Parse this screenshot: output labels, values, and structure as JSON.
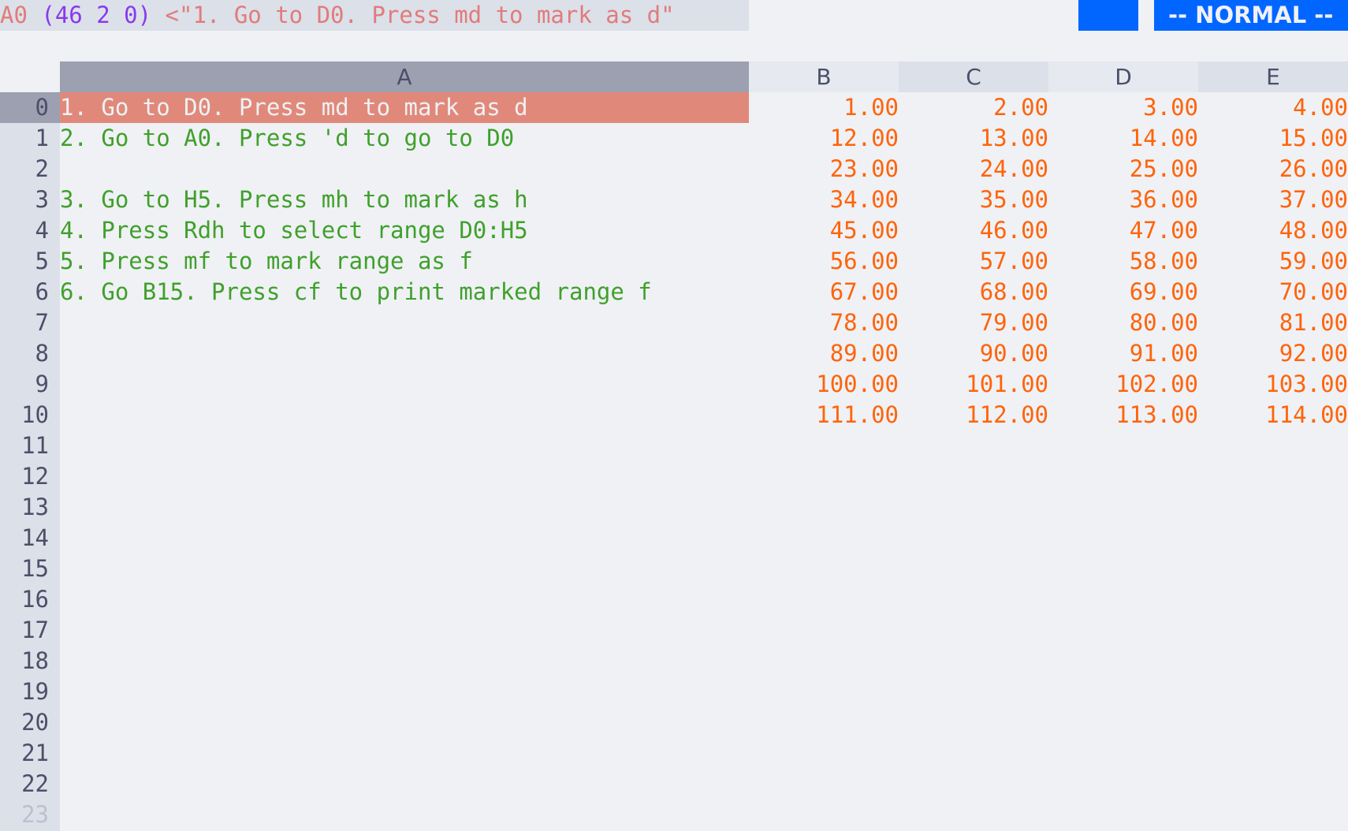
{
  "status_line": {
    "cell_ref": "A0",
    "cell_nums": "(46 2 0)",
    "cell_value": "<\"1. Go to D0. Press md to mark as d\"",
    "mode": "-- NORMAL --"
  },
  "columns": [
    "A",
    "B",
    "C",
    "D",
    "E"
  ],
  "rows": [
    {
      "n": "0",
      "a": "1. Go to D0. Press md to mark as d",
      "b": "1.00",
      "c": "2.00",
      "d": "3.00",
      "e": "4.00"
    },
    {
      "n": "1",
      "a": "2. Go to A0. Press 'd to go to D0",
      "b": "12.00",
      "c": "13.00",
      "d": "14.00",
      "e": "15.00"
    },
    {
      "n": "2",
      "a": "",
      "b": "23.00",
      "c": "24.00",
      "d": "25.00",
      "e": "26.00"
    },
    {
      "n": "3",
      "a": "3. Go to H5. Press mh to mark as h",
      "b": "34.00",
      "c": "35.00",
      "d": "36.00",
      "e": "37.00"
    },
    {
      "n": "4",
      "a": "4. Press Rdh to select range D0:H5",
      "b": "45.00",
      "c": "46.00",
      "d": "47.00",
      "e": "48.00"
    },
    {
      "n": "5",
      "a": "5. Press mf to mark range as f",
      "b": "56.00",
      "c": "57.00",
      "d": "58.00",
      "e": "59.00"
    },
    {
      "n": "6",
      "a": "6. Go B15. Press cf to print marked range f",
      "b": "67.00",
      "c": "68.00",
      "d": "69.00",
      "e": "70.00"
    },
    {
      "n": "7",
      "a": "",
      "b": "78.00",
      "c": "79.00",
      "d": "80.00",
      "e": "81.00"
    },
    {
      "n": "8",
      "a": "",
      "b": "89.00",
      "c": "90.00",
      "d": "91.00",
      "e": "92.00"
    },
    {
      "n": "9",
      "a": "",
      "b": "100.00",
      "c": "101.00",
      "d": "102.00",
      "e": "103.00"
    },
    {
      "n": "10",
      "a": "",
      "b": "111.00",
      "c": "112.00",
      "d": "113.00",
      "e": "114.00"
    },
    {
      "n": "11"
    },
    {
      "n": "12"
    },
    {
      "n": "13"
    },
    {
      "n": "14"
    },
    {
      "n": "15"
    },
    {
      "n": "16"
    },
    {
      "n": "17"
    },
    {
      "n": "18"
    },
    {
      "n": "19"
    },
    {
      "n": "20"
    },
    {
      "n": "21"
    },
    {
      "n": "22"
    },
    {
      "n": "23"
    }
  ],
  "colors": {
    "accent": "#0066ff",
    "cursor_bg": "#e0897a",
    "text_cell": "#40a02b",
    "number_cell": "#fe640b"
  }
}
